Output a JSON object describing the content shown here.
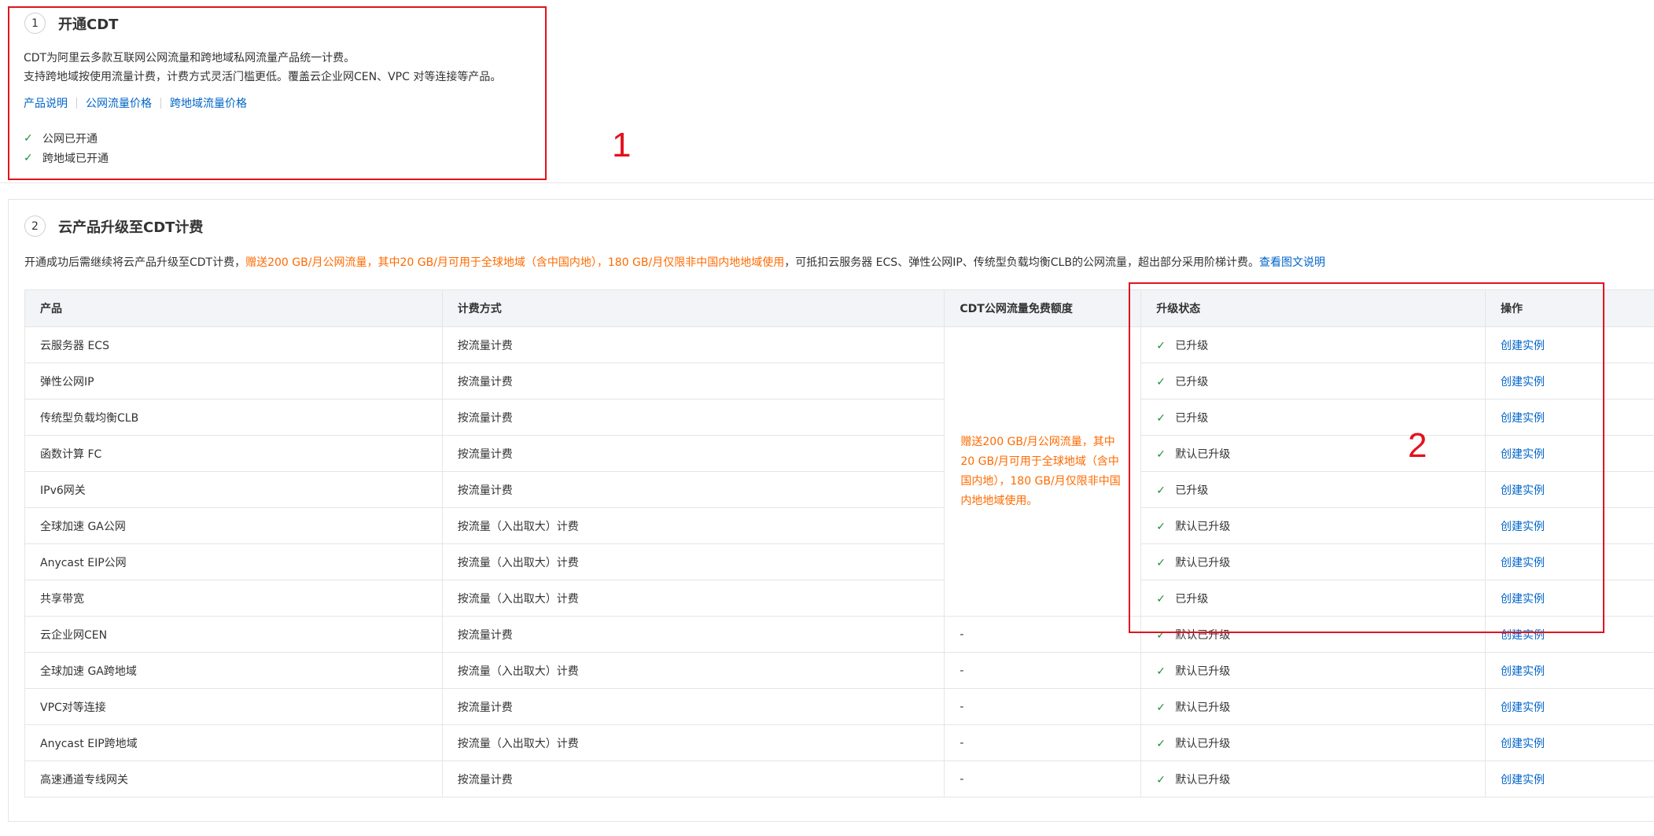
{
  "step1": {
    "number": "1",
    "title": "开通CDT",
    "desc_line1": "CDT为阿里云多款互联网公网流量和跨地域私网流量产品统一计费。",
    "desc_line2": "支持跨地域按使用流量计费，计费方式灵活门槛更低。覆盖云企业网CEN、VPC 对等连接等产品。",
    "links": [
      "产品说明",
      "公网流量价格",
      "跨地域流量价格"
    ],
    "statuses": [
      "公网已开通",
      "跨地域已开通"
    ]
  },
  "step2": {
    "number": "2",
    "title": "云产品升级至CDT计费",
    "desc_prefix": "开通成功后需继续将云产品升级至CDT计费，",
    "desc_highlight": "赠送200 GB/月公网流量，其中20 GB/月可用于全球地域（含中国内地），180 GB/月仅限非中国内地地域使用",
    "desc_suffix": "，可抵扣云服务器 ECS、弹性公网IP、传统型负载均衡CLB的公网流量，超出部分采用阶梯计费。",
    "desc_link": "查看图文说明"
  },
  "table": {
    "headers": [
      "产品",
      "计费方式",
      "CDT公网流量免费额度",
      "升级状态",
      "操作"
    ],
    "free_quota": "赠送200 GB/月公网流量，其中20 GB/月可用于全球地域（含中国内地），180 GB/月仅限非中国内地地域使用。",
    "rows": [
      {
        "product": "云服务器 ECS",
        "billing": "按流量计费",
        "quota": "",
        "status": "已升级",
        "action": "创建实例"
      },
      {
        "product": "弹性公网IP",
        "billing": "按流量计费",
        "quota": "",
        "status": "已升级",
        "action": "创建实例"
      },
      {
        "product": "传统型负载均衡CLB",
        "billing": "按流量计费",
        "quota": "",
        "status": "已升级",
        "action": "创建实例"
      },
      {
        "product": "函数计算 FC",
        "billing": "按流量计费",
        "quota": "",
        "status": "默认已升级",
        "action": "创建实例"
      },
      {
        "product": "IPv6网关",
        "billing": "按流量计费",
        "quota": "",
        "status": "已升级",
        "action": "创建实例"
      },
      {
        "product": "全球加速 GA公网",
        "billing": "按流量（入出取大）计费",
        "quota": "",
        "status": "默认已升级",
        "action": "创建实例"
      },
      {
        "product": "Anycast EIP公网",
        "billing": "按流量（入出取大）计费",
        "quota": "",
        "status": "默认已升级",
        "action": "创建实例"
      },
      {
        "product": "共享带宽",
        "billing": "按流量（入出取大）计费",
        "quota": "",
        "status": "已升级",
        "action": "创建实例"
      },
      {
        "product": "云企业网CEN",
        "billing": "按流量计费",
        "quota": "-",
        "status": "默认已升级",
        "action": "创建实例"
      },
      {
        "product": "全球加速 GA跨地域",
        "billing": "按流量（入出取大）计费",
        "quota": "-",
        "status": "默认已升级",
        "action": "创建实例"
      },
      {
        "product": "VPC对等连接",
        "billing": "按流量计费",
        "quota": "-",
        "status": "默认已升级",
        "action": "创建实例"
      },
      {
        "product": "Anycast EIP跨地域",
        "billing": "按流量（入出取大）计费",
        "quota": "-",
        "status": "默认已升级",
        "action": "创建实例"
      },
      {
        "product": "高速通道专线网关",
        "billing": "按流量计费",
        "quota": "-",
        "status": "默认已升级",
        "action": "创建实例"
      }
    ]
  },
  "annotations": [
    "1",
    "2"
  ],
  "colors": {
    "link": "#0064c8",
    "highlight": "#ff6a00",
    "annotation": "#e3121e",
    "check": "#1e8e3e"
  }
}
